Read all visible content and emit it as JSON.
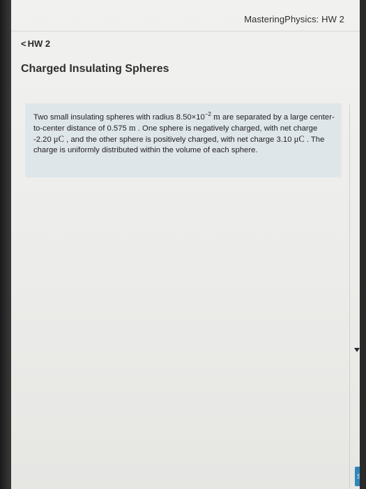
{
  "window": {
    "title": "MasteringPhysics: HW 2"
  },
  "nav": {
    "back_label": "HW 2"
  },
  "page": {
    "title": "Charged Insulating Spheres"
  },
  "problem": {
    "text_1": "Two small insulating spheres with radius 8.50×10",
    "exp_1": "−2",
    "unit_m_1": "m",
    "text_2": " are separated by a large center-to-center distance of 0.575 ",
    "unit_m_2": "m",
    "text_3": " . One sphere is negatively charged, with net charge -2.20 ",
    "unit_uc_1": "μC",
    "text_4": " , and the other sphere is positively charged, with net charge 3.10 ",
    "unit_uc_2": "μC",
    "text_5": " . The charge is uniformly distributed within the volume of each sphere."
  },
  "icons": {
    "back": "chevron-left-icon",
    "scroll": "triangle-down-icon"
  },
  "colors": {
    "problem_bg": "#dfe6ea",
    "accent": "#2f86b8"
  }
}
